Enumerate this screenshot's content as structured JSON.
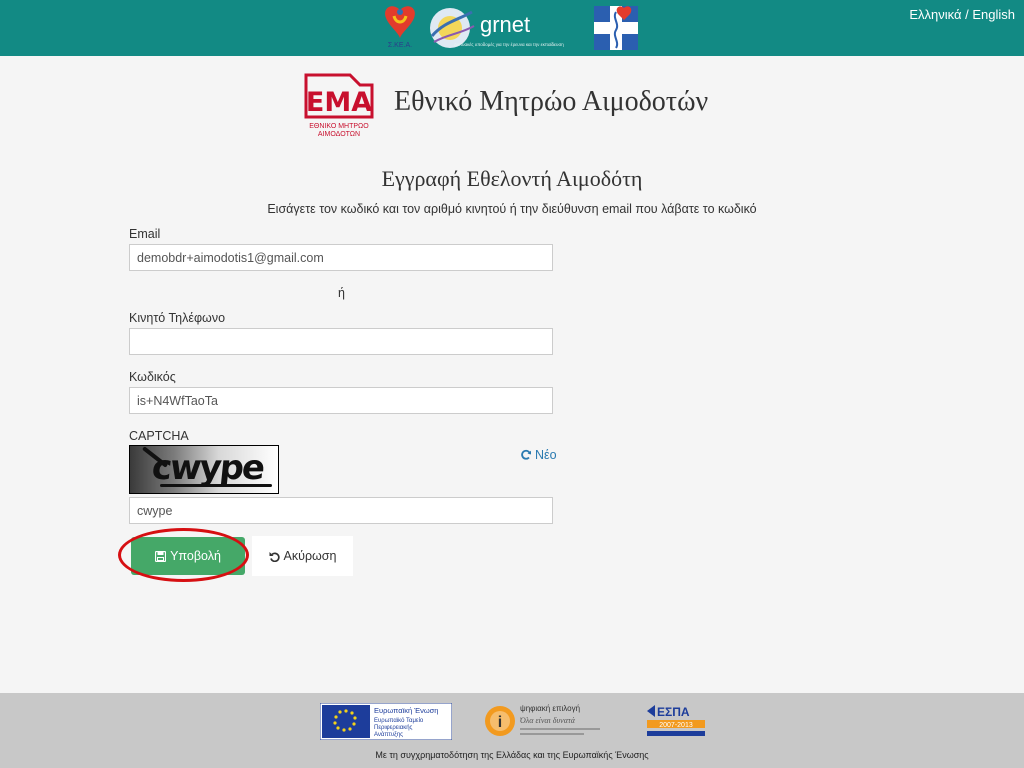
{
  "topbar": {
    "language_switch": "Ελληνικά / English",
    "logos": {
      "ssda_caption": "Σ.ΚΕ.Α.",
      "grnet_name": "grnet",
      "grnet_tagline": "Δικτυακές υποδομές για την έρευνα και την εκπαίδευση"
    }
  },
  "header": {
    "logo_letters": "ΕΜΑ",
    "logo_caption_1": "ΕΘΝΙΚΟ ΜΗΤΡΩΟ",
    "logo_caption_2": "ΑΙΜΟΔΟΤΩΝ",
    "site_title": "Εθνικό Μητρώο Αιμοδοτών"
  },
  "form": {
    "heading": "Εγγραφή Εθελοντή Αιμοδότη",
    "instructions": "Εισάγετε τον κωδικό και τον αριθμό κινητού ή την διεύθυνση email που λάβατε το κωδικό",
    "email_label": "Email",
    "email_value": "demobdr+aimodotis1@gmail.com",
    "or_text": "ή",
    "phone_label": "Κινητό Τηλέφωνο",
    "phone_value": "",
    "code_label": "Κωδικός",
    "code_value": "is+N4WfTaoTa",
    "captcha_label": "CAPTCHA",
    "captcha_image_text": "cwype",
    "captcha_refresh": "Νέο",
    "captcha_value": "cwype",
    "submit_label": "Υποβολή",
    "cancel_label": "Ακύρωση"
  },
  "footer": {
    "eu_title": "Ευρωπαϊκή Ένωση",
    "eu_fund_1": "Ευρωπαϊκό Ταμείο",
    "eu_fund_2": "Περιφερειακής",
    "eu_fund_3": "Ανάπτυξης",
    "digital_title": "ψηφιακή επιλογή",
    "digital_subtitle": "Όλα είναι δυνατά",
    "espa_title": "ΕΣΠΑ",
    "espa_years": "2007-2013",
    "cofinance_text": "Με τη συγχρηματοδότηση της Ελλάδας και της Ευρωπαϊκής Ένωσης"
  },
  "colors": {
    "topbar": "#128a84",
    "submit_button": "#45a868",
    "highlight": "#d60f12",
    "link": "#2a7ab0",
    "ema_red": "#c8102e"
  },
  "icons": {
    "submit": "floppy-disk-icon",
    "cancel": "undo-icon",
    "refresh": "refresh-icon"
  }
}
